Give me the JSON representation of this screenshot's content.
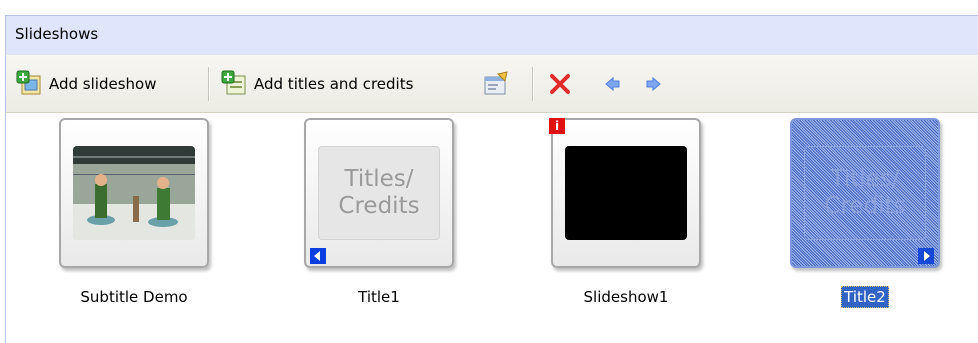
{
  "panel": {
    "title": "Slideshows"
  },
  "toolbar": {
    "add_slideshow_label": "Add slideshow",
    "add_titles_label": "Add titles and credits",
    "icons": [
      "add-slideshow-icon",
      "add-titles-icon",
      "properties-icon",
      "delete-icon",
      "move-left-icon",
      "move-right-icon"
    ]
  },
  "items": [
    {
      "caption": "Subtitle Demo",
      "kind": "video"
    },
    {
      "caption": "Title1",
      "kind": "titles",
      "slide_text_1": "Titles/",
      "slide_text_2": "Credits",
      "badge": "left-arrow"
    },
    {
      "caption": "Slideshow1",
      "kind": "black",
      "badge": "info",
      "badge_text": "i"
    },
    {
      "caption": "Title2",
      "kind": "titles",
      "slide_text_1": "Titles/",
      "slide_text_2": "Credits",
      "badge": "right-arrow",
      "selected": true
    }
  ],
  "colors": {
    "header_bg": "#dfe5fb",
    "selection": "#3163c5",
    "delete_red": "#e22b2b",
    "arrow_blue": "#4f7fe0"
  }
}
